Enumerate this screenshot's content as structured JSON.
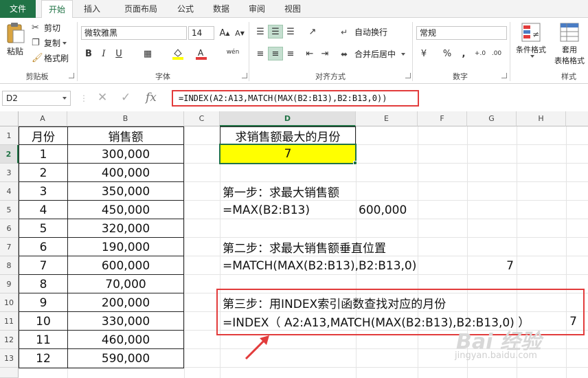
{
  "tabs": [
    "文件",
    "开始",
    "插入",
    "页面布局",
    "公式",
    "数据",
    "审阅",
    "视图"
  ],
  "clipboard": {
    "cut": "剪切",
    "copy": "复制",
    "format_painter": "格式刷",
    "paste": "粘贴",
    "group_label": "剪贴板"
  },
  "font": {
    "name": "微软雅黑",
    "size": "14",
    "bold": "B",
    "italic": "I",
    "underline": "U",
    "phonetic": "wén",
    "group_label": "字体"
  },
  "alignment": {
    "wrap_text": "自动换行",
    "merge_center": "合并后居中",
    "group_label": "对齐方式"
  },
  "number": {
    "format": "常规",
    "group_label": "数字",
    "percent": "%",
    "comma": ",",
    "inc_decimal": "+.0",
    "dec_decimal": ".00"
  },
  "styles": {
    "conditional_format": "条件格式",
    "table_format_1": "套用",
    "table_format_2": "表格格式",
    "group_label": "样式"
  },
  "formula_bar": {
    "name_box": "D2",
    "formula": "=INDEX(A2:A13,MATCH(MAX(B2:B13),B2:B13,0))"
  },
  "columns": [
    "A",
    "B",
    "C",
    "D",
    "E",
    "F",
    "G",
    "H"
  ],
  "rows": [
    "1",
    "2",
    "3",
    "4",
    "5",
    "6",
    "7",
    "8",
    "9",
    "10",
    "11",
    "12",
    "13"
  ],
  "table": {
    "header_month": "月份",
    "header_sales": "销售额",
    "months": [
      "1",
      "2",
      "3",
      "4",
      "5",
      "6",
      "7",
      "8",
      "9",
      "10",
      "11",
      "12"
    ],
    "sales": [
      "300,000",
      "400,000",
      "350,000",
      "450,000",
      "320,000",
      "190,000",
      "600,000",
      "70,000",
      "200,000",
      "330,000",
      "460,000",
      "590,000"
    ]
  },
  "result": {
    "title": "求销售额最大的月份",
    "value": "7"
  },
  "steps": {
    "step1_title": "第一步：求最大销售额",
    "step1_formula": "=MAX(B2:B13)",
    "step1_result": "600,000",
    "step2_title": "第二步：求最大销售额垂直位置",
    "step2_formula": "=MATCH(MAX(B2:B13),B2:B13,0)",
    "step2_result": "7",
    "step3_title": "第三步：用INDEX索引函数查找对应的月份",
    "step3_formula": "=INDEX（ A2:A13,MATCH(MAX(B2:B13),B2:B13,0) ）",
    "step3_result": "7"
  },
  "watermark": {
    "brand": "Bai 经验",
    "url": "jingyan.baidu.com"
  },
  "colors": {
    "excel_green": "#217346",
    "highlight_yellow": "#ffff00",
    "annotation_red": "#e23b3b"
  }
}
